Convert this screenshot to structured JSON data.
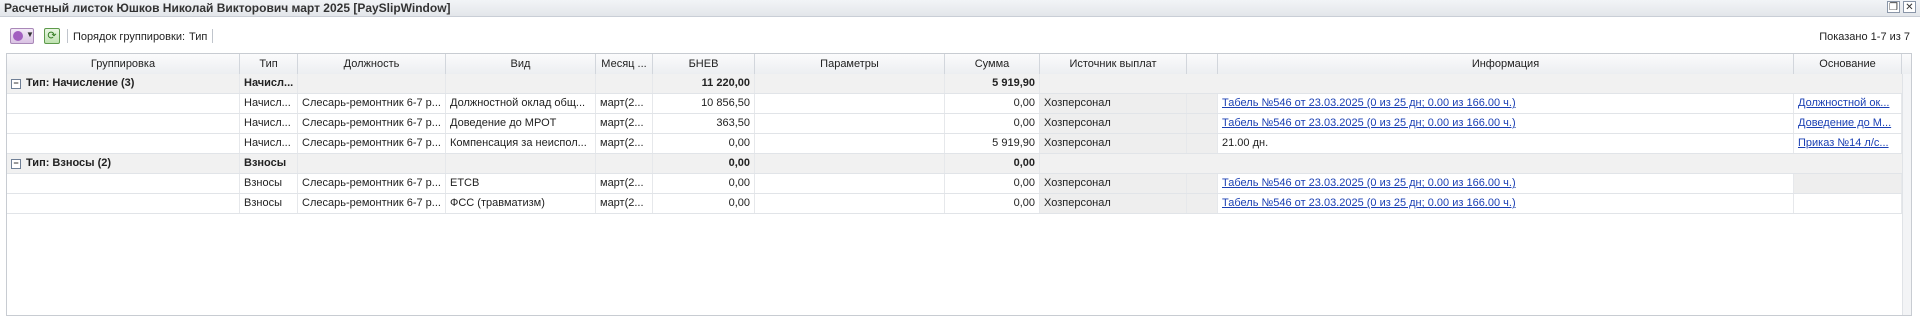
{
  "window": {
    "title": "Расчетный листок Юшков Николай Викторович март 2025 [PaySlipWindow]",
    "restore_glyph": "❐",
    "close_glyph": "✕"
  },
  "toolbar": {
    "menu_icon": "actions-menu-icon",
    "refresh_glyph": "⟳",
    "grouping_label": "Порядок группировки:",
    "grouping_value": "Тип",
    "shown_text": "Показано 1-7 из 7"
  },
  "columns": {
    "grouping": "Группировка",
    "type": "Тип",
    "position": "Должность",
    "kind": "Вид",
    "month": "Месяц ...",
    "bnev": "БНЕВ",
    "params": "Параметры",
    "amount": "Сумма",
    "source": "Источник выплат",
    "blank": "",
    "info": "Информация",
    "basis": "Основание"
  },
  "groups": [
    {
      "label": "Тип: Начисление (3)",
      "type": "Начисл...",
      "bnev": "11 220,00",
      "amount": "5 919,90",
      "expander": "−"
    },
    {
      "label": "Тип: Взносы (2)",
      "type": "Взносы",
      "bnev": "0,00",
      "amount": "0,00",
      "expander": "−"
    }
  ],
  "rows": [
    {
      "type": "Начисл...",
      "position": "Слесарь-ремонтник 6-7 р...",
      "kind": "Должностной оклад общ...",
      "month": "март(2...",
      "bnev": "10 856,50",
      "params": "",
      "amount": "0,00",
      "source": "Хозперсонал",
      "info": "Табель №546 от 23.03.2025 (0 из 25 дн; 0.00 из 166.00 ч.)",
      "basis": "Должностной ок..."
    },
    {
      "type": "Начисл...",
      "position": "Слесарь-ремонтник 6-7 р...",
      "kind": "Доведение до МРОТ",
      "month": "март(2...",
      "bnev": "363,50",
      "params": "",
      "amount": "0,00",
      "source": "Хозперсонал",
      "info": "Табель №546 от 23.03.2025 (0 из 25 дн; 0.00 из 166.00 ч.)",
      "basis": "Доведение до М..."
    },
    {
      "type": "Начисл...",
      "position": "Слесарь-ремонтник 6-7 р...",
      "kind": "Компенсация за неиспол...",
      "month": "март(2...",
      "bnev": "0,00",
      "params": "",
      "amount": "5 919,90",
      "source": "Хозперсонал",
      "info": "21.00 дн.",
      "basis": "Приказ №14 л/с..."
    },
    {
      "type": "Взносы",
      "position": "Слесарь-ремонтник 6-7 р...",
      "kind": "ЕТСВ",
      "month": "март(2...",
      "bnev": "0,00",
      "params": "",
      "amount": "0,00",
      "source": "Хозперсонал",
      "info": "Табель №546 от 23.03.2025 (0 из 25 дн; 0.00 из 166.00 ч.)",
      "basis": ""
    },
    {
      "type": "Взносы",
      "position": "Слесарь-ремонтник 6-7 р...",
      "kind": "ФСС (травматизм)",
      "month": "март(2...",
      "bnev": "0,00",
      "params": "",
      "amount": "0,00",
      "source": "Хозперсонал",
      "info": "Табель №546 от 23.03.2025 (0 из 25 дн; 0.00 из 166.00 ч.)",
      "basis": ""
    }
  ]
}
